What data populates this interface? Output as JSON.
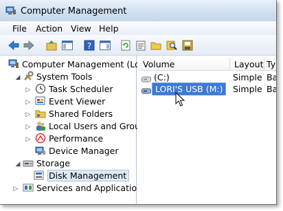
{
  "window": {
    "title": "Computer Management"
  },
  "menu": {
    "file": "File",
    "action": "Action",
    "view": "View",
    "help": "Help"
  },
  "toolbar": {
    "buttons": [
      "back-arrow-icon",
      "forward-arrow-icon",
      "up-folder-icon",
      "show-hide-tree-icon",
      "help-icon",
      "action-pane-icon",
      "refresh-icon",
      "properties-icon",
      "open-folder-icon",
      "search-icon",
      "disk-icon"
    ]
  },
  "tree": {
    "root": "Computer Management (Local",
    "system_tools": "System Tools",
    "task_scheduler": "Task Scheduler",
    "event_viewer": "Event Viewer",
    "shared_folders": "Shared Folders",
    "local_users": "Local Users and Groups",
    "performance": "Performance",
    "device_manager": "Device Manager",
    "storage": "Storage",
    "disk_management": "Disk Management",
    "services": "Services and Applications"
  },
  "list": {
    "columns": {
      "volume": "Volume",
      "layout": "Layout",
      "type": "Ty"
    },
    "rows": [
      {
        "volume": "(C:)",
        "layout": "Simple",
        "type": "Ba"
      },
      {
        "volume": "LORI'S USB (M:)",
        "layout": "Simple",
        "type": "Ba",
        "editing": true
      }
    ]
  },
  "colors": {
    "selection": "#3d79d6",
    "title_gradient_top": "#e9f1f9"
  }
}
